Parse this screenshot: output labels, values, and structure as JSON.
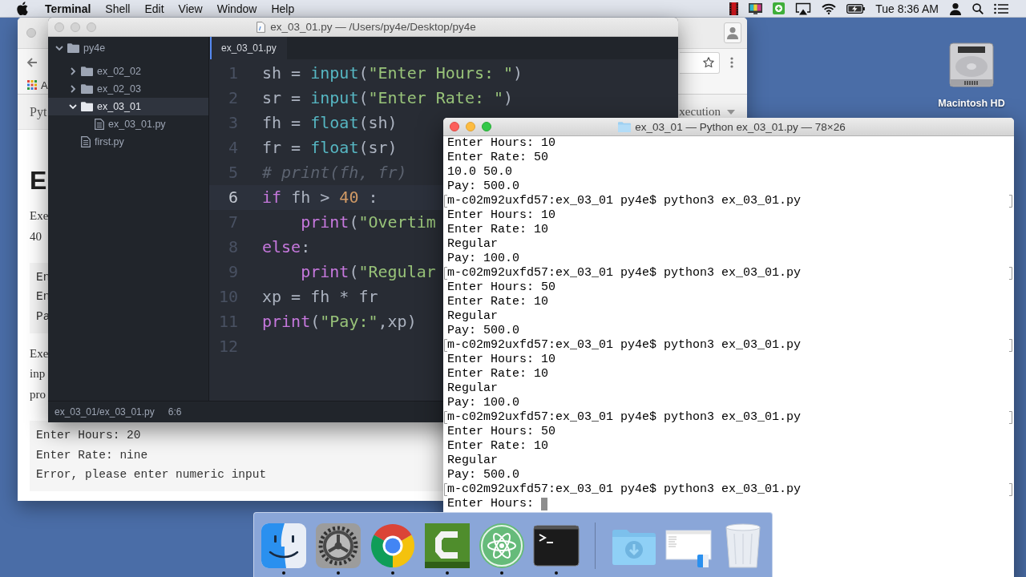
{
  "menubar": {
    "app_name": "Terminal",
    "menus": [
      "Shell",
      "Edit",
      "View",
      "Window",
      "Help"
    ],
    "clock": "Tue 8:36 AM"
  },
  "desktop": {
    "drive_label": "Macintosh HD"
  },
  "browser": {
    "bookmark": "A",
    "header": {
      "left_text": "Pyt",
      "right_text": "xecution"
    },
    "content": [
      {
        "kind": "heading",
        "lines": [
          "E"
        ]
      },
      {
        "kind": "text",
        "lines": [
          "Exe",
          "40"
        ]
      },
      {
        "kind": "code",
        "lines": [
          "En",
          "En",
          "Pa"
        ]
      },
      {
        "kind": "text",
        "lines": [
          "Exe",
          "inp",
          "pro"
        ]
      },
      {
        "kind": "code",
        "lines": [
          "Enter Hours: 20",
          "Enter Rate: nine",
          "Error, please enter numeric input"
        ]
      }
    ]
  },
  "editor": {
    "title": "ex_03_01.py — /Users/py4e/Desktop/py4e",
    "tree": {
      "label": "py4e",
      "kind": "folder",
      "expanded": true,
      "selected": false,
      "children": [
        {
          "label": "ex_02_02",
          "kind": "folder",
          "expanded": false,
          "selected": false
        },
        {
          "label": "ex_02_03",
          "kind": "folder",
          "expanded": false,
          "selected": false
        },
        {
          "label": "ex_03_01",
          "kind": "folder",
          "expanded": true,
          "selected": true,
          "children": [
            {
              "label": "ex_03_01.py",
              "kind": "file",
              "selected": false
            }
          ]
        },
        {
          "label": "first.py",
          "kind": "file",
          "selected": false
        }
      ]
    },
    "tab": {
      "label": "ex_03_01.py",
      "selected": true
    },
    "lines": [
      {
        "number": "1",
        "current": false,
        "tokens": [
          {
            "kind": "plain",
            "text": "sh = "
          },
          {
            "kind": "builtin",
            "text": "input"
          },
          {
            "kind": "plain",
            "text": "("
          },
          {
            "kind": "string",
            "text": "\"Enter Hours: \""
          },
          {
            "kind": "plain",
            "text": ")"
          }
        ]
      },
      {
        "number": "2",
        "current": false,
        "tokens": [
          {
            "kind": "plain",
            "text": "sr = "
          },
          {
            "kind": "builtin",
            "text": "input"
          },
          {
            "kind": "plain",
            "text": "("
          },
          {
            "kind": "string",
            "text": "\"Enter Rate: \""
          },
          {
            "kind": "plain",
            "text": ")"
          }
        ]
      },
      {
        "number": "3",
        "current": false,
        "tokens": [
          {
            "kind": "plain",
            "text": "fh = "
          },
          {
            "kind": "builtin",
            "text": "float"
          },
          {
            "kind": "plain",
            "text": "(sh)"
          }
        ]
      },
      {
        "number": "4",
        "current": false,
        "tokens": [
          {
            "kind": "plain",
            "text": "fr = "
          },
          {
            "kind": "builtin",
            "text": "float"
          },
          {
            "kind": "plain",
            "text": "(sr)"
          }
        ]
      },
      {
        "number": "5",
        "current": false,
        "tokens": [
          {
            "kind": "comment",
            "text": "# print(fh, fr)"
          }
        ]
      },
      {
        "number": "6",
        "current": true,
        "tokens": [
          {
            "kind": "keyword",
            "text": "if"
          },
          {
            "kind": "plain",
            "text": " fh > "
          },
          {
            "kind": "number",
            "text": "40"
          },
          {
            "kind": "plain",
            "text": " :"
          }
        ]
      },
      {
        "number": "7",
        "current": false,
        "tokens": [
          {
            "kind": "keyword",
            "text": "    print"
          },
          {
            "kind": "plain",
            "text": "("
          },
          {
            "kind": "string",
            "text": "\"Overtim"
          }
        ]
      },
      {
        "number": "8",
        "current": false,
        "tokens": [
          {
            "kind": "keyword",
            "text": "else"
          },
          {
            "kind": "plain",
            "text": ":"
          }
        ]
      },
      {
        "number": "9",
        "current": false,
        "tokens": [
          {
            "kind": "keyword",
            "text": "    print"
          },
          {
            "kind": "plain",
            "text": "("
          },
          {
            "kind": "string",
            "text": "\"Regular"
          }
        ]
      },
      {
        "number": "10",
        "current": false,
        "tokens": [
          {
            "kind": "plain",
            "text": "xp = fh * fr"
          }
        ]
      },
      {
        "number": "11",
        "current": false,
        "tokens": [
          {
            "kind": "keyword",
            "text": "print"
          },
          {
            "kind": "plain",
            "text": "("
          },
          {
            "kind": "string",
            "text": "\"Pay:\""
          },
          {
            "kind": "plain",
            "text": ",xp)"
          }
        ]
      },
      {
        "number": "12",
        "current": false
      }
    ],
    "status": {
      "path": "ex_03_01/ex_03_01.py",
      "position": "6:6"
    }
  },
  "terminal": {
    "title": "ex_03_01 — Python ex_03_01.py — 78×26",
    "lines": [
      {
        "text": "Enter Hours: 10",
        "marked": false
      },
      {
        "text": "Enter Rate: 50",
        "marked": false
      },
      {
        "text": "10.0 50.0",
        "marked": false
      },
      {
        "text": "Pay: 500.0",
        "marked": false
      },
      {
        "text": "m-c02m92uxfd57:ex_03_01 py4e$ python3 ex_03_01.py",
        "marked": true
      },
      {
        "text": "Enter Hours: 10",
        "marked": false
      },
      {
        "text": "Enter Rate: 10",
        "marked": false
      },
      {
        "text": "Regular",
        "marked": false
      },
      {
        "text": "Pay: 100.0",
        "marked": false
      },
      {
        "text": "m-c02m92uxfd57:ex_03_01 py4e$ python3 ex_03_01.py",
        "marked": true
      },
      {
        "text": "Enter Hours: 50",
        "marked": false
      },
      {
        "text": "Enter Rate: 10",
        "marked": false
      },
      {
        "text": "Regular",
        "marked": false
      },
      {
        "text": "Pay: 500.0",
        "marked": false
      },
      {
        "text": "m-c02m92uxfd57:ex_03_01 py4e$ python3 ex_03_01.py",
        "marked": true
      },
      {
        "text": "Enter Hours: 10",
        "marked": false
      },
      {
        "text": "Enter Rate: 10",
        "marked": false
      },
      {
        "text": "Regular",
        "marked": false
      },
      {
        "text": "Pay: 100.0",
        "marked": false
      },
      {
        "text": "m-c02m92uxfd57:ex_03_01 py4e$ python3 ex_03_01.py",
        "marked": true
      },
      {
        "text": "Enter Hours: 50",
        "marked": false
      },
      {
        "text": "Enter Rate: 10",
        "marked": false
      },
      {
        "text": "Regular",
        "marked": false
      },
      {
        "text": "Pay: 500.0",
        "marked": false
      },
      {
        "text": "m-c02m92uxfd57:ex_03_01 py4e$ python3 ex_03_01.py",
        "marked": true
      },
      {
        "text": "Enter Hours:",
        "marked": false
      }
    ],
    "cursor": true
  },
  "dock": {
    "apps": [
      {
        "kind": "files",
        "running": true
      },
      {
        "kind": "settings",
        "running": true
      },
      {
        "kind": "browser",
        "running": true
      },
      {
        "kind": "recorder",
        "running": true
      },
      {
        "kind": "editor",
        "running": true
      },
      {
        "kind": "terminal",
        "running": true
      }
    ],
    "stacks": [
      {
        "kind": "downloads"
      },
      {
        "kind": "window"
      },
      {
        "kind": "trash"
      }
    ]
  }
}
